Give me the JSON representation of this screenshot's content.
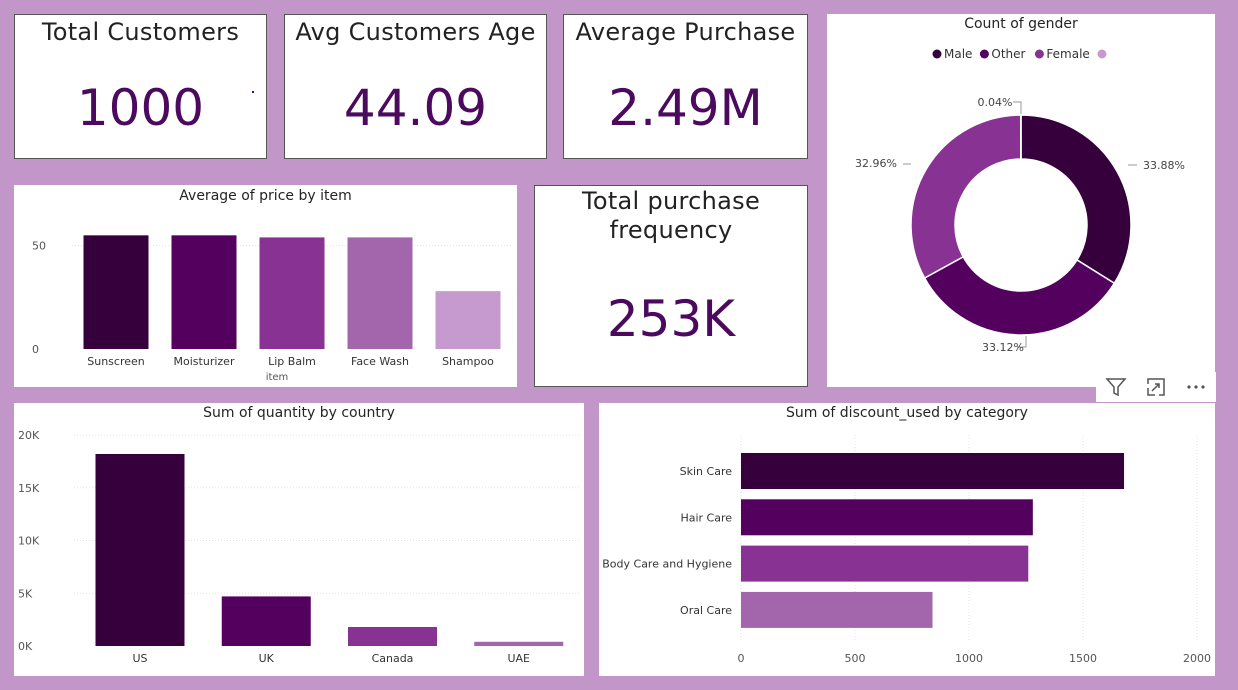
{
  "kpis": {
    "total_customers": {
      "title": "Total Customers",
      "value": "1000"
    },
    "avg_age": {
      "title": "Avg Customers Age",
      "value": "44.09"
    },
    "avg_purchase": {
      "title": "Average Purchase",
      "value": "2.49M"
    },
    "purchase_freq": {
      "title_line1": "Total purchase",
      "title_line2": "frequency",
      "value": "253K"
    }
  },
  "colors": {
    "series": [
      "#36003d",
      "#54005f",
      "#883393",
      "#a366ad",
      "#c69ace"
    ],
    "background": "#c396c9",
    "kpi_value": "#4b0a5e"
  },
  "chart_data": [
    {
      "id": "price_by_item",
      "type": "bar",
      "title": "Average of price by item",
      "xlabel": "item",
      "ylabel": "",
      "categories": [
        "Sunscreen",
        "Moisturizer",
        "Lip Balm",
        "Face Wash",
        "Shampoo"
      ],
      "values": [
        55,
        55,
        54,
        54,
        28
      ],
      "ylim": [
        0,
        60
      ],
      "yticks": [
        "0",
        "50"
      ],
      "grid": true
    },
    {
      "id": "gender_donut",
      "type": "pie",
      "title": "Count of gender",
      "legend": [
        "Male",
        "Other",
        "Female",
        ""
      ],
      "legend_position": "top",
      "slices": [
        {
          "name": "Male",
          "value": 33.88,
          "label": "33.88%"
        },
        {
          "name": "Other",
          "value": 33.12,
          "label": "33.12%"
        },
        {
          "name": "Female",
          "value": 32.96,
          "label": "32.96%"
        },
        {
          "name": "",
          "value": 0.04,
          "label": "0.04%"
        }
      ]
    },
    {
      "id": "qty_by_country",
      "type": "bar",
      "title": "Sum of quantity by country",
      "categories": [
        "US",
        "UK",
        "Canada",
        "UAE"
      ],
      "values": [
        18200,
        4700,
        1800,
        400
      ],
      "ylim": [
        0,
        20000
      ],
      "yticks": [
        "0K",
        "5K",
        "10K",
        "15K",
        "20K"
      ],
      "grid": true
    },
    {
      "id": "discount_by_category",
      "type": "bar",
      "orientation": "horizontal",
      "title": "Sum of discount_used by category",
      "categories": [
        "Skin Care",
        "Hair Care",
        "Body Care and Hygiene",
        "Oral Care"
      ],
      "values": [
        1680,
        1280,
        1260,
        840
      ],
      "xlim": [
        0,
        2000
      ],
      "xticks": [
        "0",
        "500",
        "1000",
        "1500",
        "2000"
      ],
      "grid": true
    }
  ],
  "toolbar": {
    "filter_icon": "filter-icon",
    "focus_icon": "focus-mode-icon",
    "more_icon": "more-options-icon"
  }
}
